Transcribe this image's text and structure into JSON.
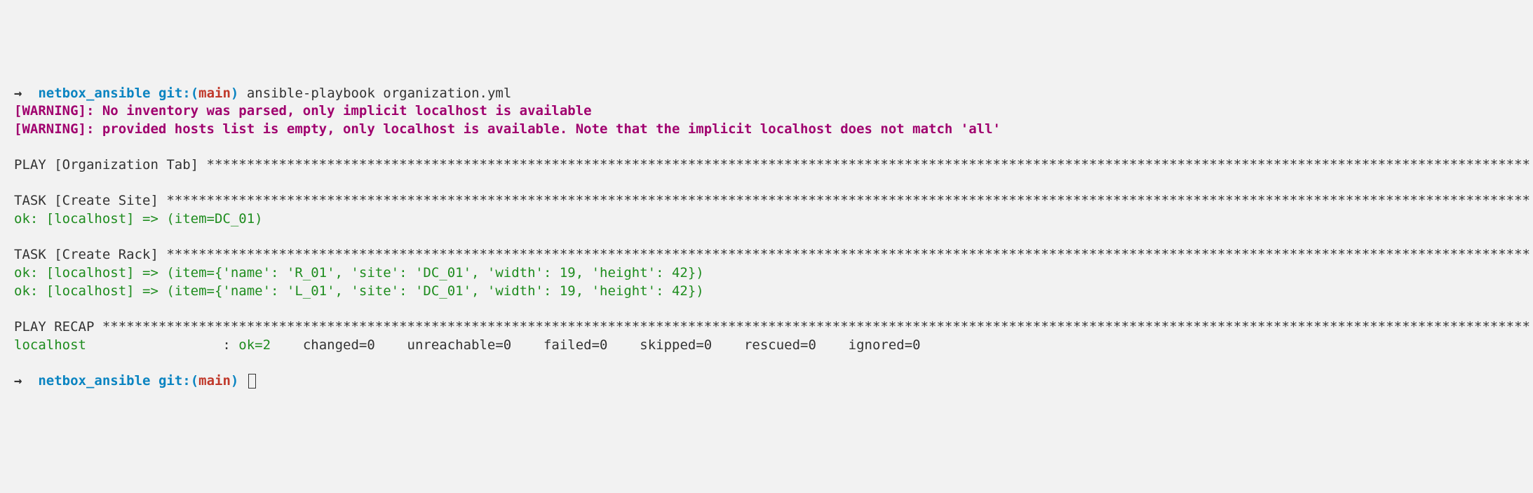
{
  "prompt1": {
    "arrow": "→  ",
    "dir": "netbox_ansible",
    "git_label": "git:",
    "paren_open": "(",
    "branch": "main",
    "paren_close": ")",
    "command": " ansible-playbook organization.yml"
  },
  "warnings": {
    "line1": "[WARNING]: No inventory was parsed, only implicit localhost is available",
    "line2": "[WARNING]: provided hosts list is empty, only localhost is available. Note that the implicit localhost does not match 'all'"
  },
  "play_header": "PLAY [Organization Tab] *********************************************************************************************************************************************************************",
  "task1": {
    "header": "TASK [Create Site] **************************************************************************************************************************************************************************",
    "item1": "ok: [localhost] => (item=DC_01)"
  },
  "task2": {
    "header": "TASK [Create Rack] **************************************************************************************************************************************************************************",
    "item1": "ok: [localhost] => (item={'name': 'R_01', 'site': 'DC_01', 'width': 19, 'height': 42})",
    "item2": "ok: [localhost] => (item={'name': 'L_01', 'site': 'DC_01', 'width': 19, 'height': 42})"
  },
  "recap": {
    "header": "PLAY RECAP **********************************************************************************************************************************************************************************",
    "host": "localhost",
    "spacing": "                 : ",
    "ok": "ok=2   ",
    "rest": " changed=0    unreachable=0    failed=0    skipped=0    rescued=0    ignored=0"
  },
  "prompt2": {
    "arrow": "→  ",
    "dir": "netbox_ansible",
    "git_label": "git:",
    "paren_open": "(",
    "branch": "main",
    "paren_close": ")"
  }
}
